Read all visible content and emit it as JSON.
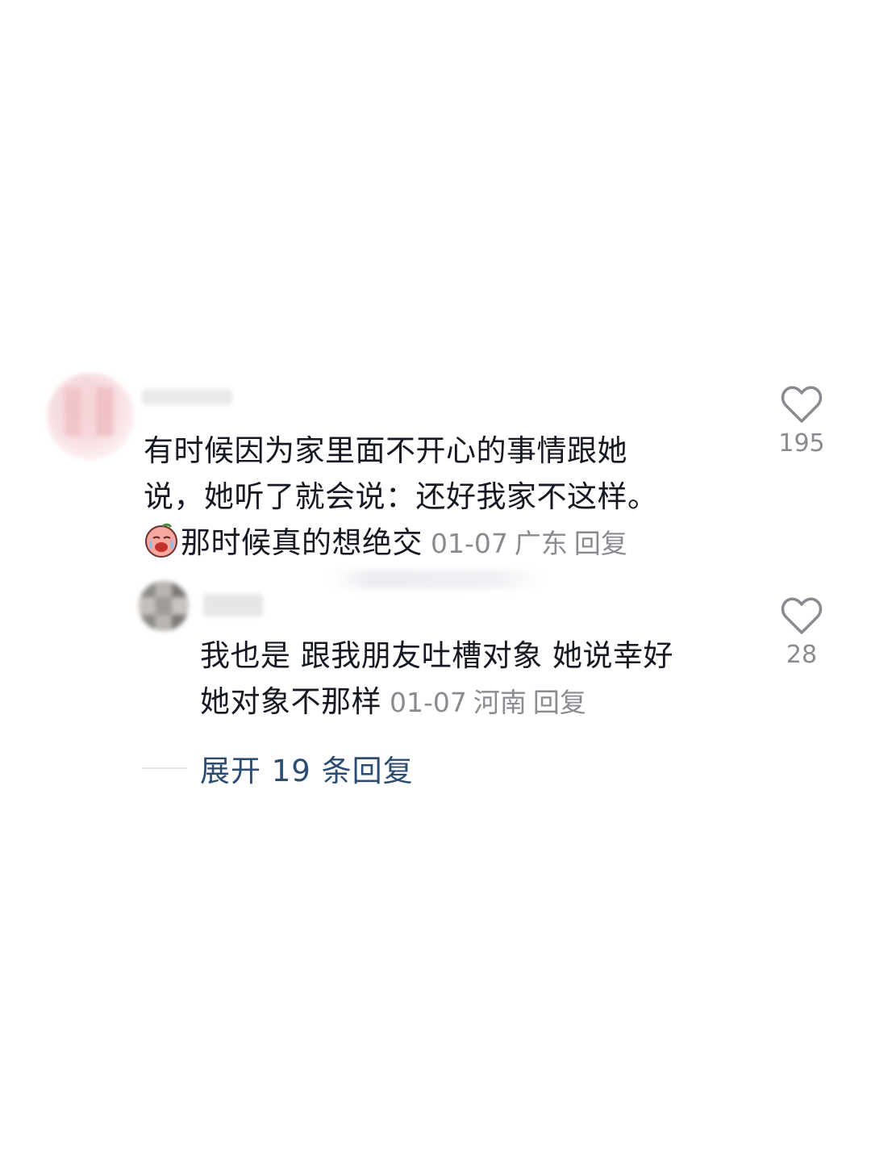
{
  "comments": [
    {
      "text_line1": "有时候因为家里面不开心的事情跟她",
      "text_line2": "说，她听了就会说：还好我家不这样。",
      "text_line3": "那时候真的想绝交",
      "emoji": "crying-face-emoji",
      "date": "01-07",
      "location": "广东",
      "reply_label": "回复",
      "likes": "195"
    }
  ],
  "reply": {
    "text_line1": "我也是 跟我朋友吐槽对象 她说幸好",
    "text_line2": "她对象不那样",
    "date": "01-07",
    "location": "河南",
    "reply_label": "回复",
    "likes": "28"
  },
  "expand": {
    "label": "展开 19 条回复"
  },
  "colors": {
    "text": "#161823",
    "meta": "#8a8b91",
    "expand_link": "#2d4c72"
  }
}
